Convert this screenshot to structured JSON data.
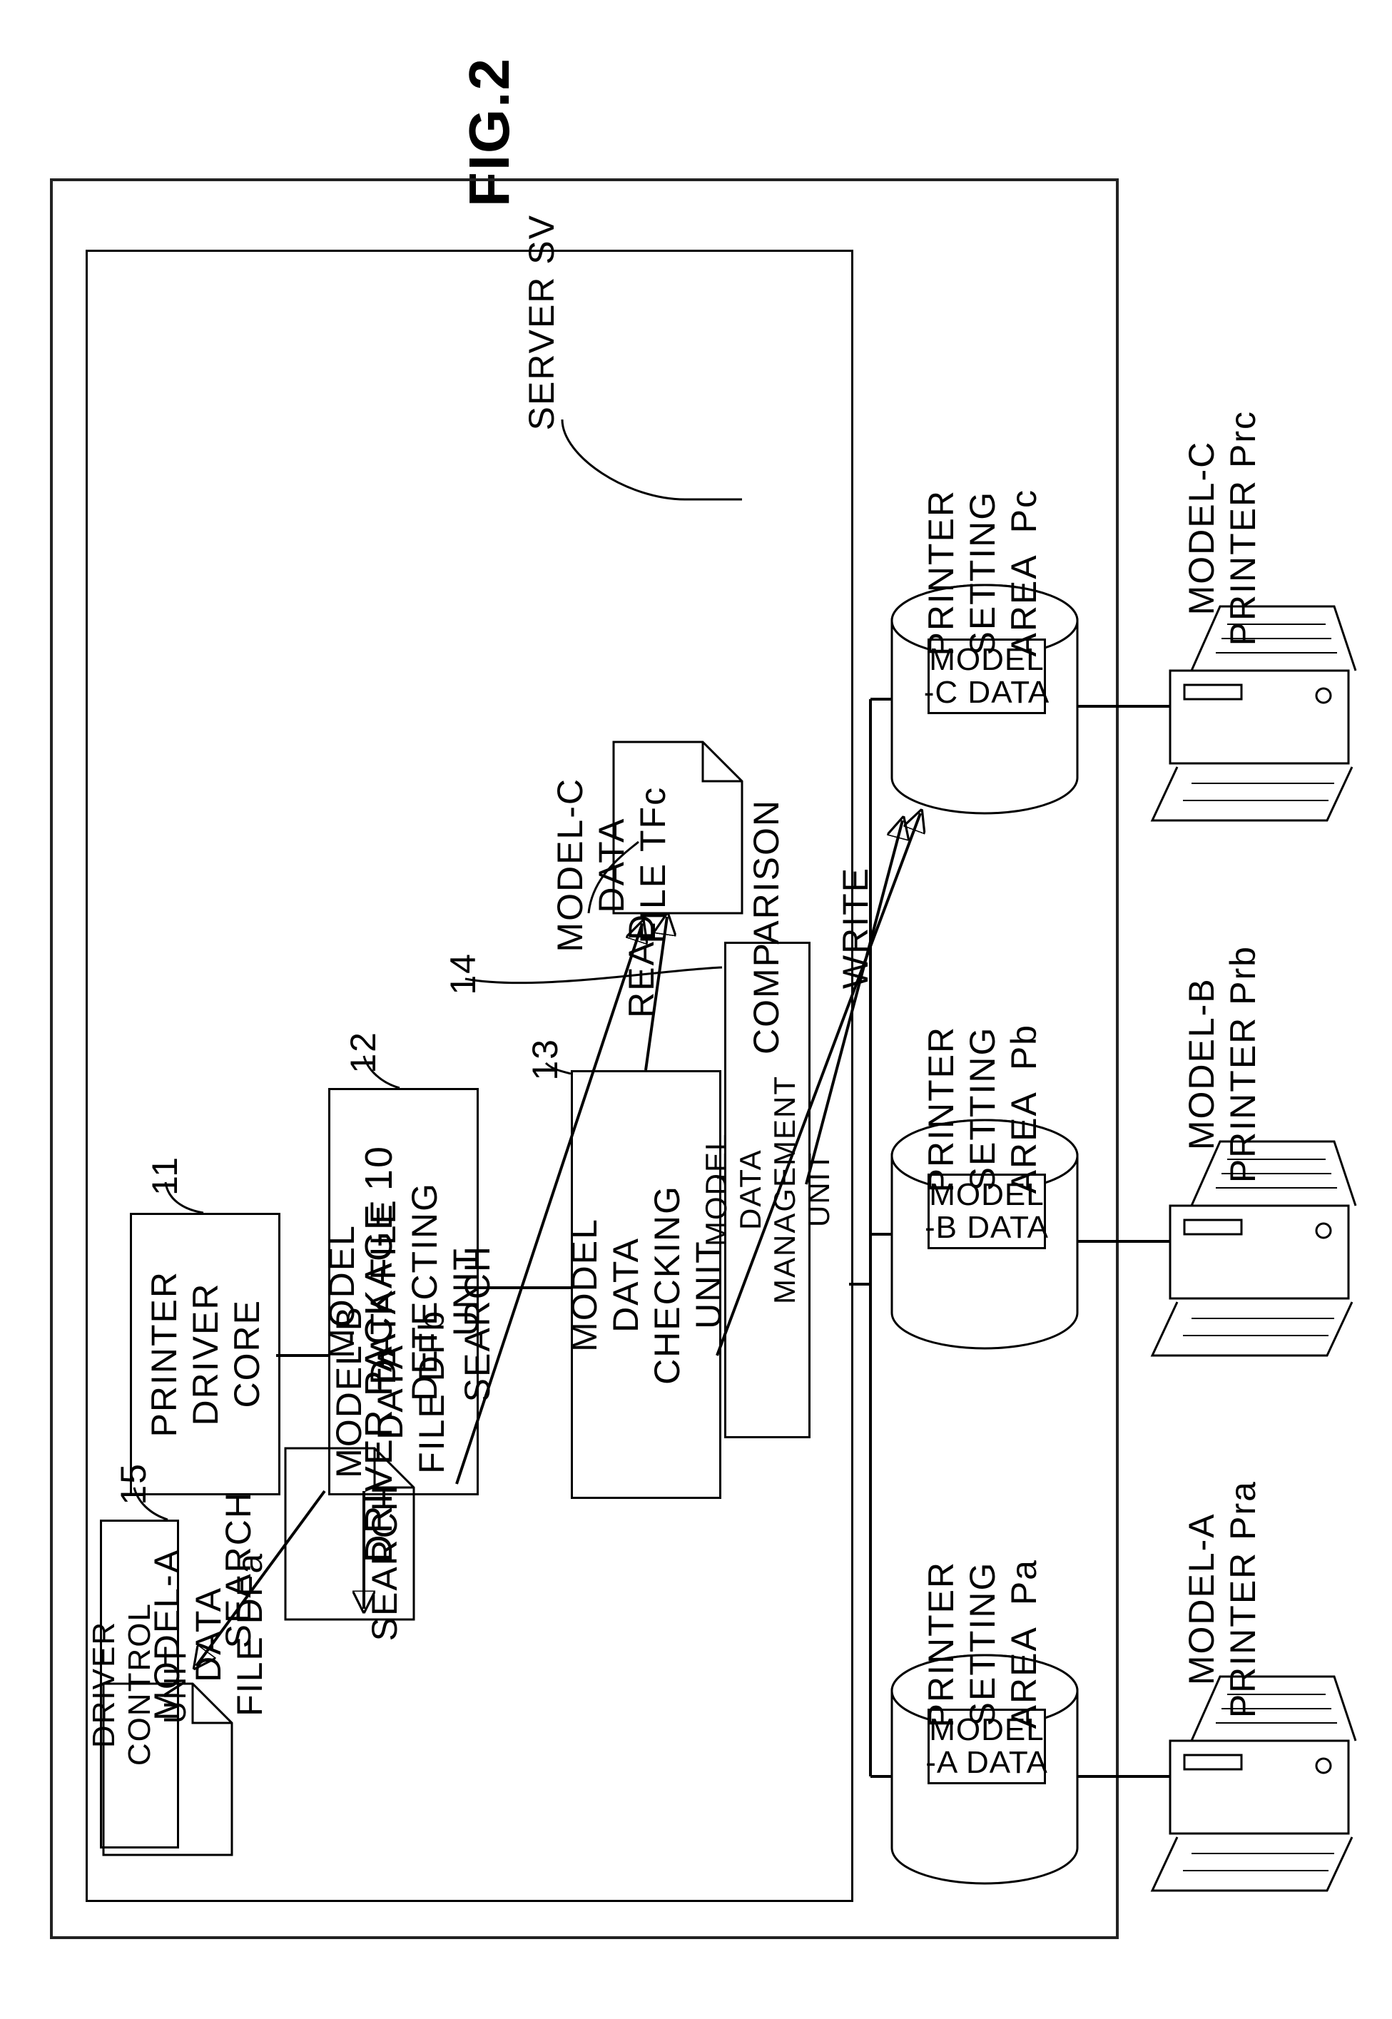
{
  "figure_label": "FIG.2",
  "server_label": "SERVER SV",
  "driver_package_label": "DRIVER PACKAGE 10",
  "files": {
    "a": "MODEL-A\nDATA\nFILE DFa",
    "b": "MODEL-B\nDATA\nFILE DFb",
    "c": "MODEL-C\nDATA\nFILE TFc"
  },
  "arrow_labels": {
    "search_a": "SEARCH",
    "search_b": "SEARCH",
    "search_c": "SEARCH",
    "read": "READ",
    "comparison": "COMPARISON",
    "write": "WRITE"
  },
  "units": {
    "printer_driver_core": "PRINTER\nDRIVER\nCORE",
    "model_data_file_detecting_unit": "MODEL\nDATA FILE\nDETECTING\nUNIT",
    "model_data_checking_unit": "MODEL\nDATA\nCHECKING\nUNIT",
    "model_data_management_unit": "MODEL\nDATA\nMANAGEMENT\nUNIT",
    "driver_control_unit": "DRIVER\nCONTROL\nUNIT"
  },
  "unit_nums": {
    "printer_driver_core": "11",
    "model_data_file_detecting_unit": "12",
    "model_data_checking_unit": "13",
    "model_data_management_unit": "14",
    "driver_control_unit": "15"
  },
  "data_chips": {
    "a": "MODEL\n-A DATA",
    "b": "MODEL\n-B DATA",
    "c": "MODEL\n-C DATA"
  },
  "setting_areas": {
    "a": "PRINTER\nSETTING\nAREA  Pa",
    "b": "PRINTER\nSETTING\nAREA  Pb",
    "c": "PRINTER\nSETTING\nAREA  Pc"
  },
  "printers": {
    "a": "MODEL-A\nPRINTER Pra",
    "b": "MODEL-B\nPRINTER Prb",
    "c": "MODEL-C\nPRINTER Prc"
  }
}
